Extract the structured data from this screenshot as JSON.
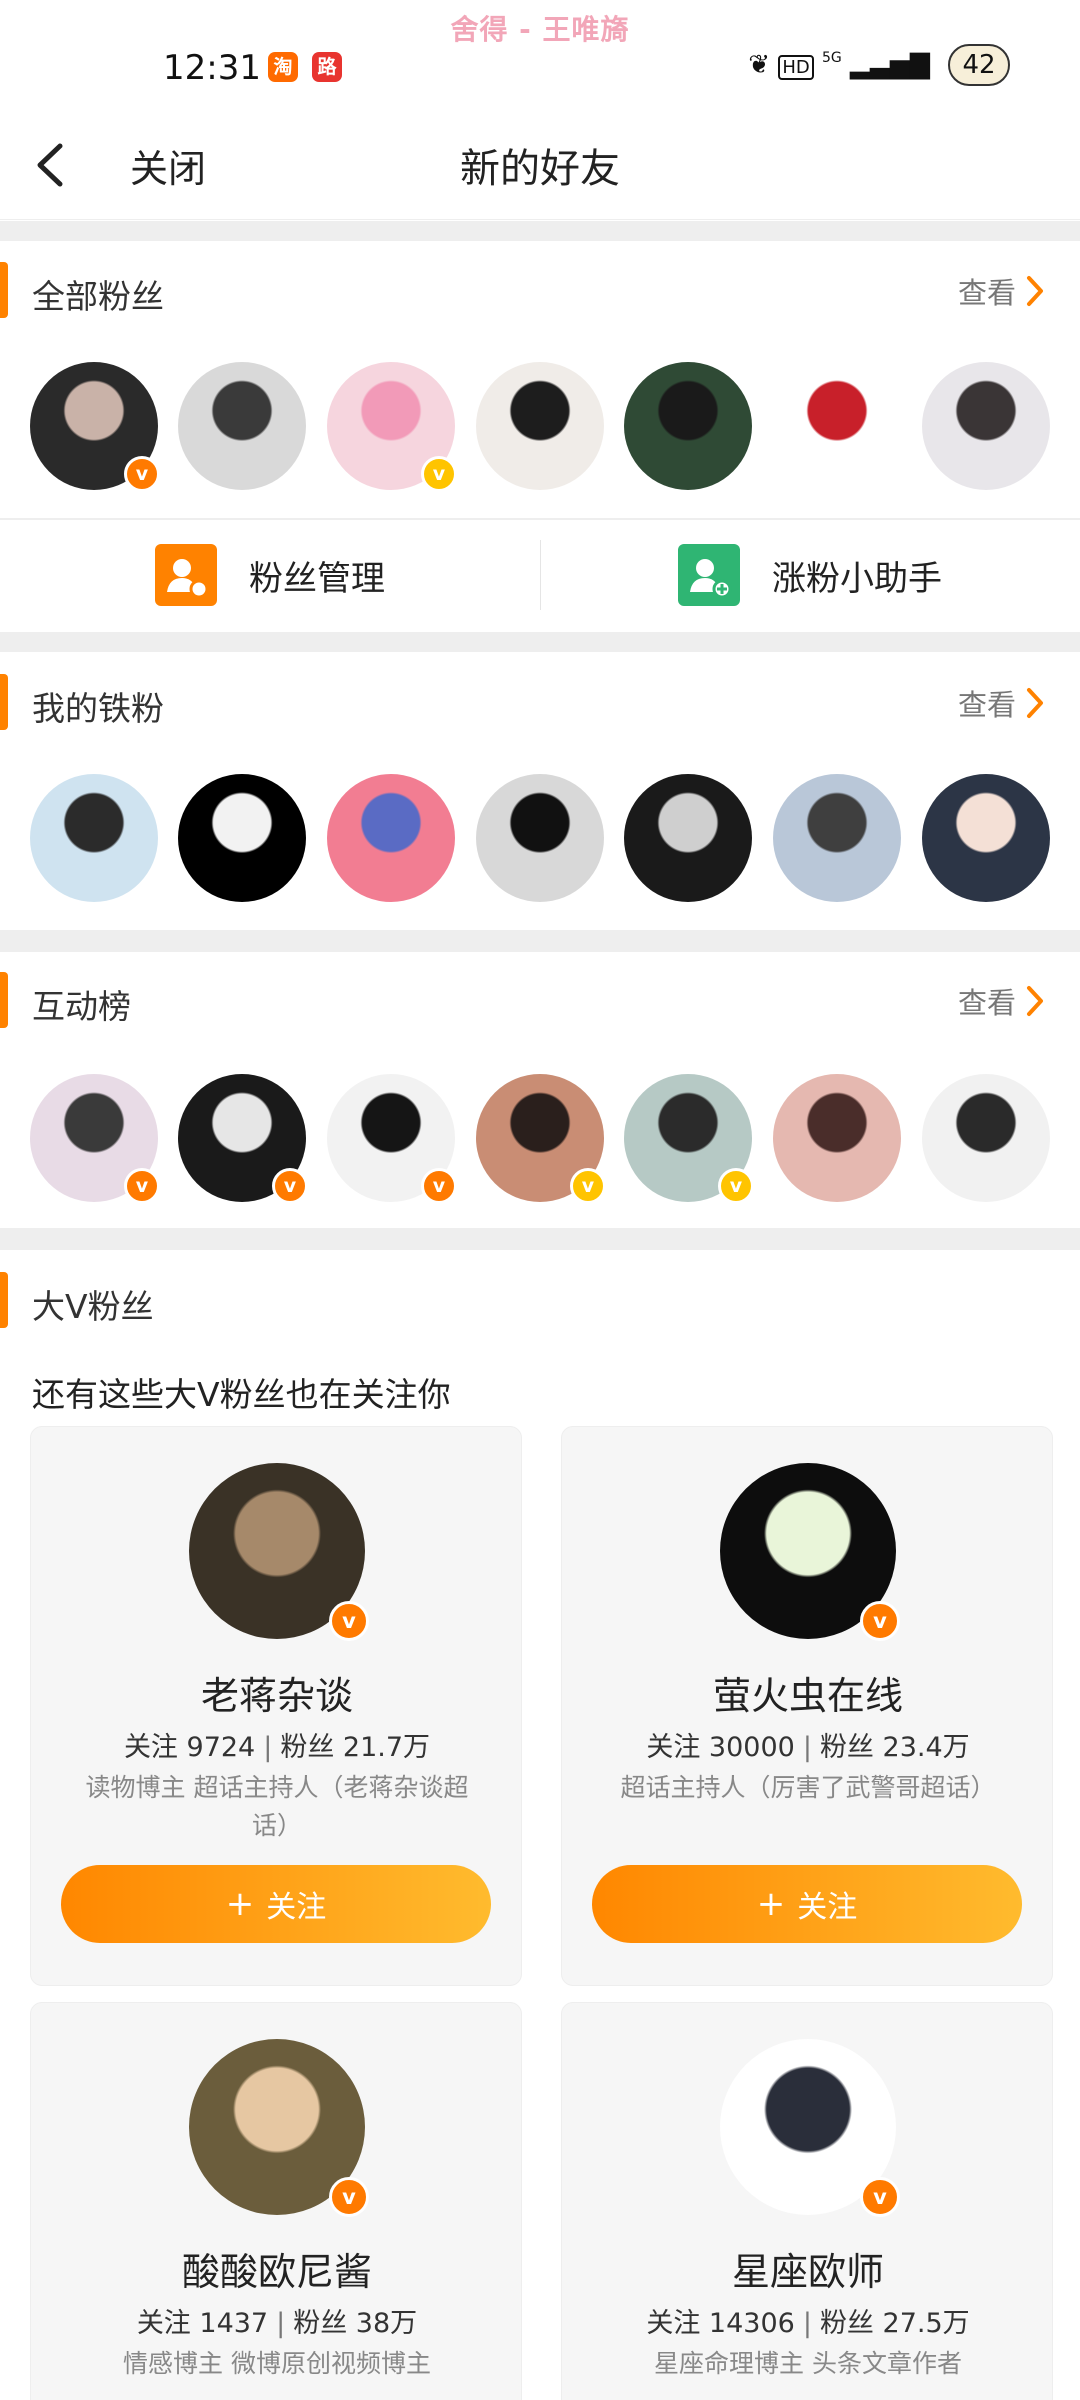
{
  "status_bar": {
    "time": "12:31",
    "music_banner": "舍得 - 王唯旖",
    "app_icons": [
      "淘",
      "路"
    ],
    "signal_text": "5G",
    "battery": "42"
  },
  "nav": {
    "back_icon": "chevron-left-icon",
    "close_label": "关闭",
    "title": "新的好友"
  },
  "all_fans": {
    "title": "全部粉丝",
    "view_label": "查看",
    "avatars": [
      {
        "colors": [
          "#2a2a2a",
          "#c9b2a8"
        ],
        "badge": "orange"
      },
      {
        "colors": [
          "#d9d9d9",
          "#3a3a3a"
        ],
        "badge": null
      },
      {
        "colors": [
          "#f6d5de",
          "#f29ab8"
        ],
        "badge": "gold"
      },
      {
        "colors": [
          "#f0ece8",
          "#1d1d1d"
        ],
        "badge": null
      },
      {
        "colors": [
          "#2f4a35",
          "#1a1a1a"
        ],
        "badge": null
      },
      {
        "colors": [
          "#ffffff",
          "#c8202a"
        ],
        "badge": null
      },
      {
        "colors": [
          "#e8e6ea",
          "#3a3536"
        ],
        "badge": null
      }
    ]
  },
  "management": {
    "fans_manage_label": "粉丝管理",
    "fans_helper_label": "涨粉小助手",
    "manage_color": "#ff8200",
    "helper_color": "#2fb573"
  },
  "iron_fans": {
    "title": "我的铁粉",
    "view_label": "查看",
    "avatars": [
      {
        "colors": [
          "#cfe3f0",
          "#2b2b2b"
        ],
        "badge": null
      },
      {
        "colors": [
          "#000000",
          "#f2f2f2"
        ],
        "badge": null
      },
      {
        "colors": [
          "#f27d92",
          "#5a6bc4"
        ],
        "badge": null
      },
      {
        "colors": [
          "#d8d8d8",
          "#111111"
        ],
        "badge": null
      },
      {
        "colors": [
          "#1a1a1a",
          "#cfcfcf"
        ],
        "badge": null
      },
      {
        "colors": [
          "#b9c7d8",
          "#3f3f3f"
        ],
        "badge": null
      },
      {
        "colors": [
          "#2c3546",
          "#f4e0d6"
        ],
        "badge": null
      }
    ]
  },
  "interaction": {
    "title": "互动榜",
    "view_label": "查看",
    "avatars": [
      {
        "colors": [
          "#e8dbe6",
          "#3a3a3a"
        ],
        "badge": "orange"
      },
      {
        "colors": [
          "#1a1a1a",
          "#e6e6e6"
        ],
        "badge": "orange"
      },
      {
        "colors": [
          "#f2f2f2",
          "#151515"
        ],
        "badge": "orange"
      },
      {
        "colors": [
          "#c98d74",
          "#2a1f1c"
        ],
        "badge": "gold"
      },
      {
        "colors": [
          "#b6c9c5",
          "#2b2b2b"
        ],
        "badge": "gold"
      },
      {
        "colors": [
          "#e5b8b0",
          "#4a2d2a"
        ],
        "badge": null
      },
      {
        "colors": [
          "#f1f1f1",
          "#2a2a2a"
        ],
        "badge": null
      }
    ]
  },
  "big_v": {
    "title": "大V粉丝",
    "subtitle": "还有这些大V粉丝也在关注你",
    "follow_label": "关注",
    "cards": [
      {
        "name": "老蒋杂谈",
        "following_label": "关注",
        "following": "9724",
        "fans_label": "粉丝",
        "fans": "21.7万",
        "desc": "读物博主 超话主持人（老蒋杂谈超话）",
        "colors": [
          "#3a3226",
          "#a6896a"
        ]
      },
      {
        "name": "萤火虫在线",
        "following_label": "关注",
        "following": "30000",
        "fans_label": "粉丝",
        "fans": "23.4万",
        "desc": "超话主持人（厉害了武警哥超话）",
        "colors": [
          "#0d0d0d",
          "#e9f5d9"
        ]
      },
      {
        "name": "酸酸欧尼酱",
        "following_label": "关注",
        "following": "1437",
        "fans_label": "粉丝",
        "fans": "38万",
        "desc": "情感博主 微博原创视频博主",
        "colors": [
          "#6b5d3c",
          "#e6c7a2"
        ]
      },
      {
        "name": "星座欧师",
        "following_label": "关注",
        "following": "14306",
        "fans_label": "粉丝",
        "fans": "27.5万",
        "desc": "星座命理博主 头条文章作者",
        "colors": [
          "#ffffff",
          "#2a2e3a"
        ]
      }
    ]
  },
  "colors": {
    "accent": "#ff8200",
    "verified_orange": "#ff7a00",
    "verified_gold": "#ffc400",
    "separator": "#eeeeee"
  }
}
